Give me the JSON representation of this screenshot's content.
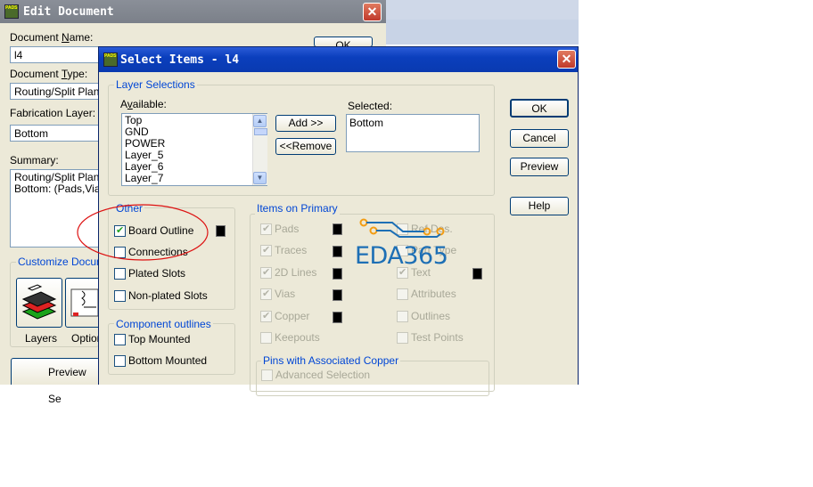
{
  "bg_window": {
    "title": "Edit Document",
    "doc_name_label": "Document Name:",
    "doc_name_value": "l4",
    "doc_type_label": "Document Type:",
    "doc_type_value": "Routing/Split Plane",
    "fab_layer_label": "Fabrication Layer:",
    "fab_layer_value": "Bottom",
    "summary_label": "Summary:",
    "summary_lines": [
      "Routing/Split Plane:",
      "Bottom: (Pads,Vias,"
    ],
    "ok_label": "OK",
    "customize_label": "Customize Docume",
    "layers_label": "Layers",
    "options_label": "Option",
    "preview_label": "Preview Se"
  },
  "dialog": {
    "title": "Select Items - l4",
    "layer_selections": {
      "title": "Layer Selections",
      "available_label": "Available:",
      "available_items": [
        "Top",
        "GND",
        "POWER",
        "Layer_5",
        "Layer_6",
        "Layer_7"
      ],
      "add_label": "Add >>",
      "remove_label": "<<Remove",
      "selected_label": "Selected:",
      "selected_items": [
        "Bottom"
      ]
    },
    "buttons": {
      "ok": "OK",
      "cancel": "Cancel",
      "preview": "Preview",
      "help": "Help"
    },
    "other": {
      "title": "Other",
      "items": [
        {
          "label": "Board Outline",
          "checked": true
        },
        {
          "label": "Connections",
          "checked": false
        },
        {
          "label": "Plated Slots",
          "checked": false
        },
        {
          "label": "Non-plated Slots",
          "checked": false
        }
      ]
    },
    "component_outlines": {
      "title": "Component outlines",
      "items": [
        {
          "label": "Top Mounted",
          "checked": false
        },
        {
          "label": "Bottom Mounted",
          "checked": false
        }
      ]
    },
    "items_on_primary": {
      "title": "Items on Primary",
      "left": [
        {
          "label": "Pads",
          "checked": true
        },
        {
          "label": "Traces",
          "checked": true
        },
        {
          "label": "2D Lines",
          "checked": true
        },
        {
          "label": "Vias",
          "checked": true
        },
        {
          "label": "Copper",
          "checked": true
        },
        {
          "label": "Keepouts",
          "checked": false
        }
      ],
      "right": [
        {
          "label": "Ref.Des.",
          "checked": false
        },
        {
          "label": "Part Type",
          "checked": false
        },
        {
          "label": "Text",
          "checked": true
        },
        {
          "label": "Attributes",
          "checked": false
        },
        {
          "label": "Outlines",
          "checked": false
        },
        {
          "label": "Test Points",
          "checked": false
        }
      ]
    },
    "pins_copper": {
      "title": "Pins with Associated Copper",
      "advanced_label": "Advanced Selection"
    }
  },
  "watermark": {
    "text": "EDA365"
  },
  "colors": {
    "title_blue": "#0a3ab0",
    "group_label": "#0046d5",
    "annotation_red": "#d11",
    "watermark": "#1d6fb5",
    "watermark_orange": "#f39c12"
  }
}
